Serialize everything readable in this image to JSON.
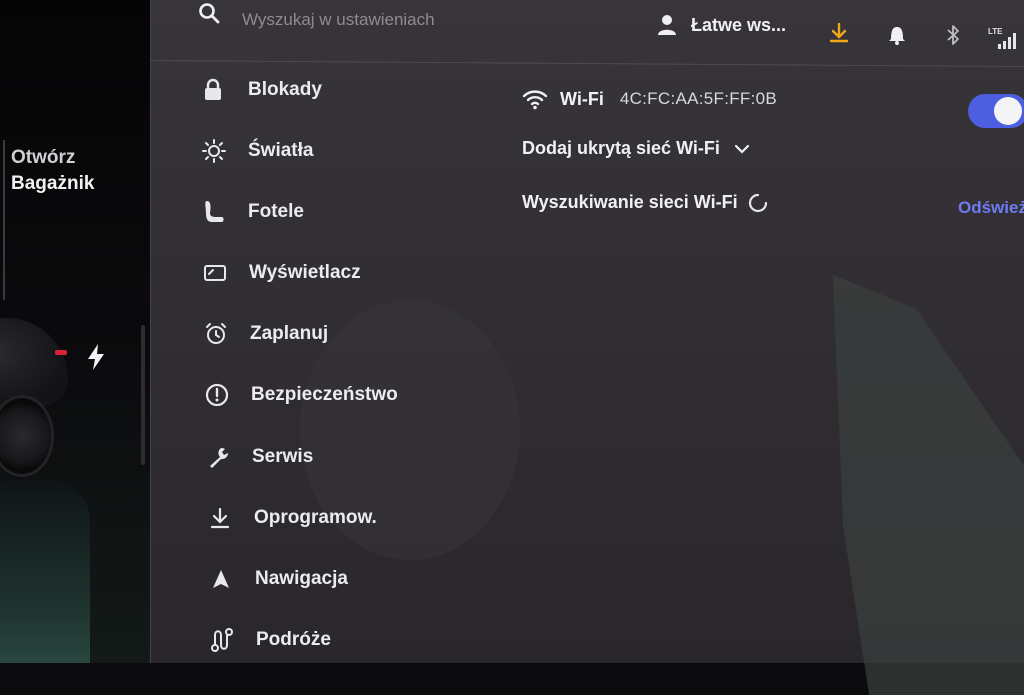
{
  "left_strip": {
    "trunk_line1": "Otwórz",
    "trunk_line2": "Bagażnik",
    "charge_icon": "lightning-bolt-icon"
  },
  "topbar": {
    "search_placeholder": "Wyszukaj w ustawieniach",
    "profile_name": "Łatwe ws...",
    "icons": [
      "search-icon",
      "person-icon",
      "download-icon",
      "bell-icon",
      "bluetooth-icon",
      "lte-signal-icon"
    ],
    "lte_label": "LTE",
    "download_color": "#f2a61c"
  },
  "menu": {
    "items": [
      {
        "label": "Blokady",
        "icon": "lock-icon"
      },
      {
        "label": "Światła",
        "icon": "sun-icon"
      },
      {
        "label": "Fotele",
        "icon": "seat-icon"
      },
      {
        "label": "Wyświetlacz",
        "icon": "display-icon"
      },
      {
        "label": "Zaplanuj",
        "icon": "alarm-clock-icon"
      },
      {
        "label": "Bezpieczeństwo",
        "icon": "alert-circle-icon"
      },
      {
        "label": "Serwis",
        "icon": "wrench-icon"
      },
      {
        "label": "Oprogramow.",
        "icon": "download-icon"
      },
      {
        "label": "Nawigacja",
        "icon": "navigation-arrow-icon"
      },
      {
        "label": "Podróże",
        "icon": "route-icon"
      }
    ]
  },
  "wifi": {
    "label": "Wi-Fi",
    "mac": "4C:FC:AA:5F:FF:0B",
    "enabled": true,
    "toggle_color": "#4b5fe0",
    "add_hidden_label": "Dodaj ukrytą sieć Wi-Fi",
    "scanning_label": "Wyszukiwanie sieci Wi-Fi",
    "refresh_label": "Odśwież"
  }
}
